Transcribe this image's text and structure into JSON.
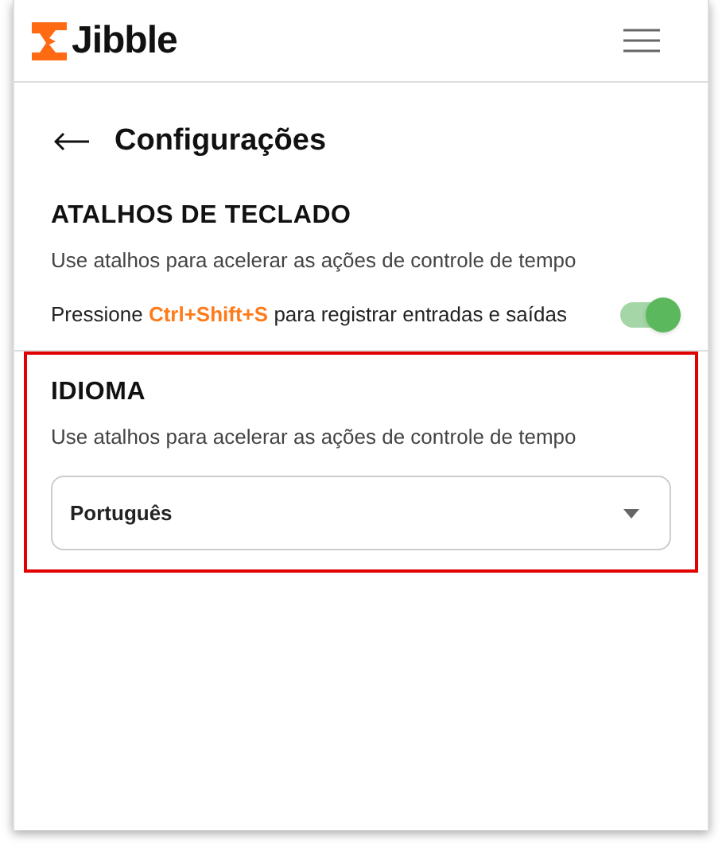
{
  "header": {
    "logo_text": "Jibble"
  },
  "page": {
    "title": "Configurações"
  },
  "sections": [
    {
      "kind": "toggle",
      "heading": "ATALHOS DE TECLADO",
      "description": "Use atalhos para acelerar as ações de controle de tempo",
      "setting": {
        "prefix": "Pressione",
        "shortcut": "Ctrl+Shift+S",
        "suffix": "para registrar entradas e saídas",
        "on": true
      }
    },
    {
      "kind": "select",
      "heading": "IDIOMA",
      "description": "Use atalhos para acelerar as ações de controle de tempo",
      "highlighted": true,
      "value": "Português"
    }
  ]
}
